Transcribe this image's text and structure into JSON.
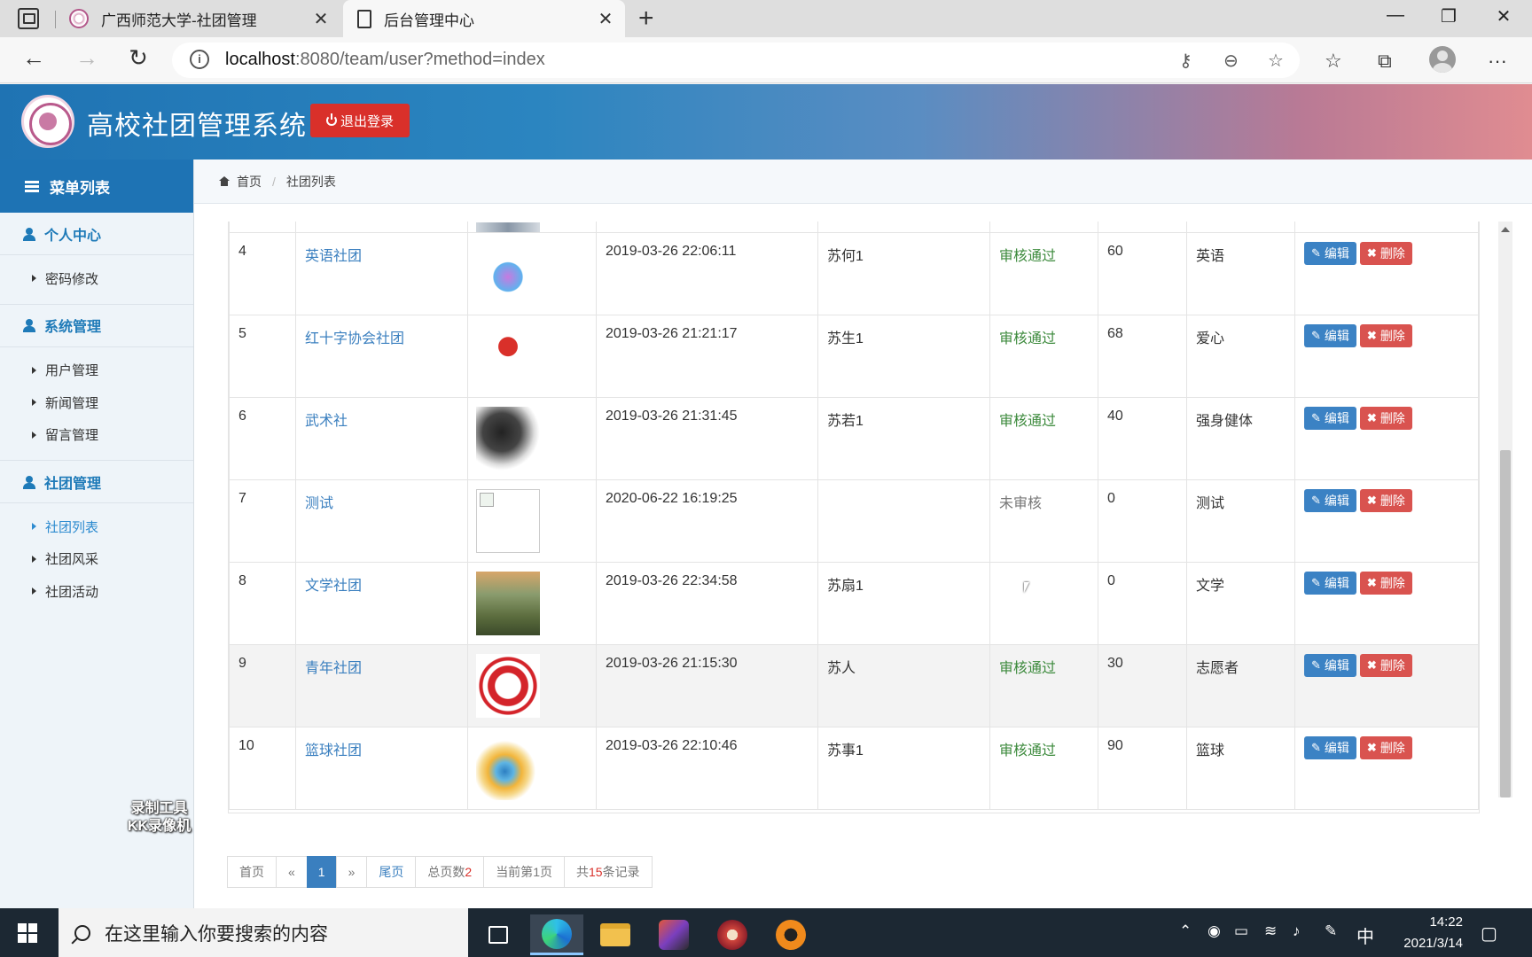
{
  "browser": {
    "tabs": [
      {
        "title": "广西师范大学-社团管理",
        "active": false
      },
      {
        "title": "后台管理中心",
        "active": true
      }
    ],
    "url_host": "localhost",
    "url_rest": ":8080/team/user?method=index",
    "window_controls": {
      "minimize": "—",
      "maximize": "❐",
      "close": "✕"
    }
  },
  "header": {
    "title": "高校社团管理系统",
    "logout_label": "退出登录"
  },
  "sidebar": {
    "heading": "菜单列表",
    "groups": [
      {
        "label": "个人中心",
        "items": [
          "密码修改"
        ]
      },
      {
        "label": "系统管理",
        "items": [
          "用户管理",
          "新闻管理",
          "留言管理"
        ]
      },
      {
        "label": "社团管理",
        "items": [
          "社团列表",
          "社团风采",
          "社团活动"
        ],
        "active_item": "社团列表"
      }
    ]
  },
  "breadcrumb": {
    "home": "首页",
    "current": "社团列表"
  },
  "table": {
    "rows": [
      {
        "id": "4",
        "name": "英语社团",
        "logo": "english-club-logo",
        "time": "2019-03-26 22:06:11",
        "manager": "苏何1",
        "status": "审核通过",
        "members": "60",
        "category": "英语"
      },
      {
        "id": "5",
        "name": "红十字协会社团",
        "logo": "red-cross-logo",
        "time": "2019-03-26 21:21:17",
        "manager": "苏生1",
        "status": "审核通过",
        "members": "68",
        "category": "爱心"
      },
      {
        "id": "6",
        "name": "武术社",
        "logo": "wushu-calligraphy-logo",
        "time": "2019-03-26 21:31:45",
        "manager": "苏若1",
        "status": "审核通过",
        "members": "40",
        "category": "强身健体"
      },
      {
        "id": "7",
        "name": "测试",
        "logo": "broken-image",
        "time": "2020-06-22 16:19:25",
        "manager": "",
        "status": "未审核",
        "members": "0",
        "category": "测试"
      },
      {
        "id": "8",
        "name": "文学社团",
        "logo": "mountain-photo",
        "time": "2019-03-26 22:34:58",
        "manager": "苏扇1",
        "status": "",
        "members": "0",
        "category": "文学"
      },
      {
        "id": "9",
        "name": "青年社团",
        "logo": "youth-volunteer-logo",
        "time": "2019-03-26 21:15:30",
        "manager": "苏人",
        "status": "审核通过",
        "members": "30",
        "category": "志愿者"
      },
      {
        "id": "10",
        "name": "篮球社团",
        "logo": "basketball-flame-logo",
        "time": "2019-03-26 22:10:46",
        "manager": "苏事1",
        "status": "审核通过",
        "members": "90",
        "category": "篮球"
      }
    ],
    "edit_label": "编辑",
    "delete_label": "删除"
  },
  "pager": {
    "first": "首页",
    "prev": "«",
    "current": "1",
    "next": "»",
    "last": "尾页",
    "total_pages_label": "总页数",
    "total_pages": "2",
    "current_page_prefix": "当前第",
    "current_page": "1",
    "current_page_suffix": "页",
    "total_records_prefix": "共",
    "total_records": "15",
    "total_records_suffix": "条记录"
  },
  "watermark": {
    "line1": "录制工具",
    "line2": "KK录像机"
  },
  "taskbar": {
    "search_placeholder": "在这里输入你要搜索的内容",
    "ime": "中",
    "time": "14:22",
    "date": "2021/3/14"
  },
  "colors": {
    "accent": "#1e73b4",
    "danger": "#d9302a",
    "success": "#3c8a3c"
  }
}
